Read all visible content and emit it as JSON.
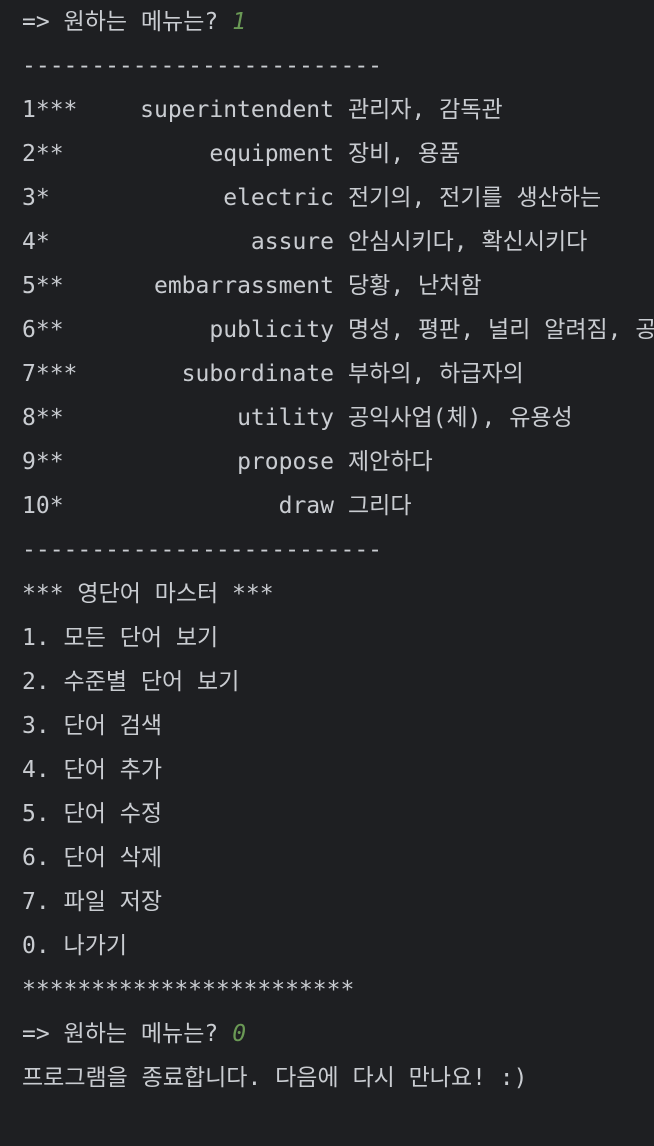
{
  "prompt1": {
    "label": "=> 원하는 메뉴는?",
    "input": "1"
  },
  "separator": "--------------------------",
  "words": [
    {
      "num": "1***",
      "eng": "superintendent",
      "kor": "관리자, 감독관"
    },
    {
      "num": "2**",
      "eng": "equipment",
      "kor": "장비, 용품"
    },
    {
      "num": "3*",
      "eng": "electric",
      "kor": "전기의, 전기를 생산하는"
    },
    {
      "num": "4*",
      "eng": "assure",
      "kor": "안심시키다, 확신시키다"
    },
    {
      "num": "5**",
      "eng": "embarrassment",
      "kor": "당황, 난처함"
    },
    {
      "num": "6**",
      "eng": "publicity",
      "kor": "명성, 평판, 널리 알려짐, 공"
    },
    {
      "num": "7***",
      "eng": "subordinate",
      "kor": "부하의, 하급자의"
    },
    {
      "num": "8**",
      "eng": "utility",
      "kor": "공익사업(체), 유용성"
    },
    {
      "num": "9**",
      "eng": "propose",
      "kor": "제안하다"
    },
    {
      "num": "10*",
      "eng": "draw",
      "kor": "그리다"
    }
  ],
  "separator2": "--------------------------",
  "menu": {
    "title": "*** 영단어 마스터 ***",
    "items": [
      "1. 모든 단어 보기",
      "2. 수준별 단어 보기",
      "3. 단어 검색",
      "4. 단어 추가",
      "5. 단어 수정",
      "6. 단어 삭제",
      "7. 파일 저장",
      "0. 나가기"
    ],
    "footer": "************************"
  },
  "prompt2": {
    "label": "=> 원하는 메뉴는?",
    "input": "0"
  },
  "exit_message": "프로그램을 종료합니다. 다음에 다시 만나요! :)"
}
